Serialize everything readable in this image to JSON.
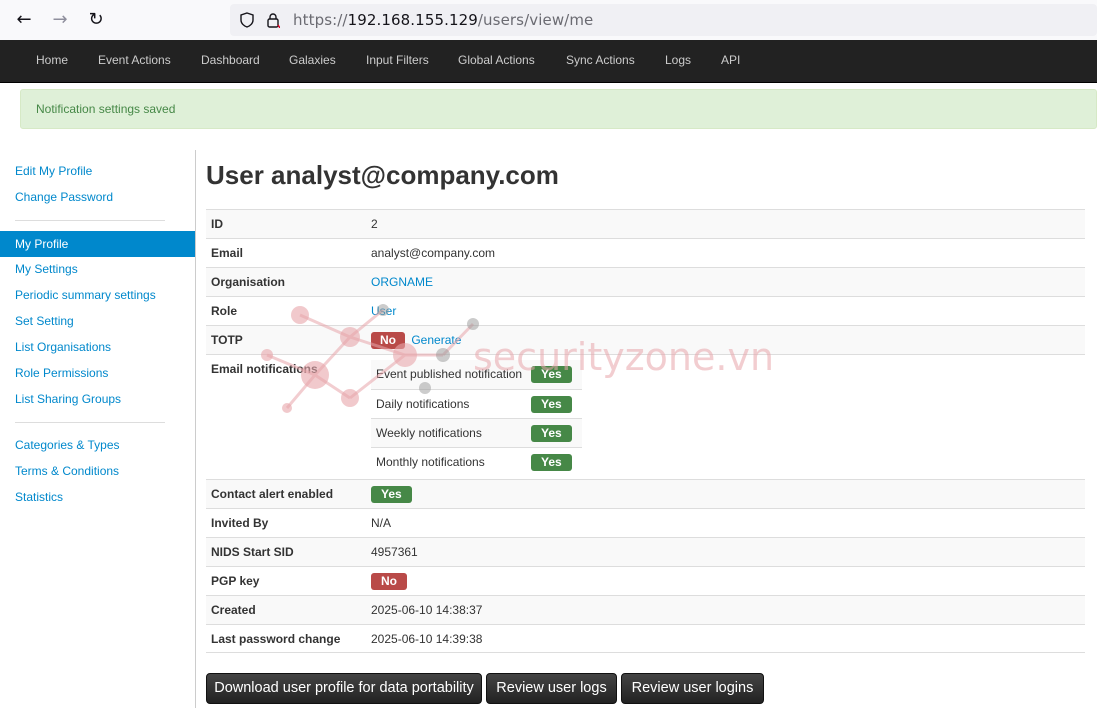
{
  "browser": {
    "url_prefix": "https://",
    "url_host": "192.168.155.129",
    "url_path": "/users/view/me"
  },
  "topnav": [
    "Home",
    "Event Actions",
    "Dashboard",
    "Galaxies",
    "Input Filters",
    "Global Actions",
    "Sync Actions",
    "Logs",
    "API"
  ],
  "alert": {
    "message": "Notification settings saved"
  },
  "sidebar": {
    "group1": [
      "Edit My Profile",
      "Change Password"
    ],
    "active": "My Profile",
    "group2": [
      "My Settings",
      "Periodic summary settings",
      "Set Setting",
      "List Organisations",
      "Role Permissions",
      "List Sharing Groups"
    ],
    "group3": [
      "Categories & Types",
      "Terms & Conditions",
      "Statistics"
    ]
  },
  "page": {
    "title": "User analyst@company.com"
  },
  "details": {
    "id_label": "ID",
    "id_value": "2",
    "email_label": "Email",
    "email_value": "analyst@company.com",
    "org_label": "Organisation",
    "org_value": "ORGNAME",
    "role_label": "Role",
    "role_value": "User",
    "totp_label": "TOTP",
    "totp_badge": "No",
    "totp_link": "Generate",
    "notif_label": "Email notifications",
    "notifications": [
      {
        "label": "Event published notification",
        "value": "Yes"
      },
      {
        "label": "Daily notifications",
        "value": "Yes"
      },
      {
        "label": "Weekly notifications",
        "value": "Yes"
      },
      {
        "label": "Monthly notifications",
        "value": "Yes"
      }
    ],
    "contact_label": "Contact alert enabled",
    "contact_badge": "Yes",
    "invited_label": "Invited By",
    "invited_value": "N/A",
    "nids_label": "NIDS Start SID",
    "nids_value": "4957361",
    "pgp_label": "PGP key",
    "pgp_badge": "No",
    "created_label": "Created",
    "created_value": "2025-06-10 14:38:37",
    "pwchange_label": "Last password change",
    "pwchange_value": "2025-06-10 14:39:38"
  },
  "buttons": {
    "download": "Download user profile for data portability",
    "logs": "Review user logs",
    "logins": "Review user logins"
  },
  "watermark": {
    "text": "securityzone.vn"
  },
  "colors": {
    "link": "#0088cc",
    "success": "#468847",
    "danger": "#b94a48",
    "navbar": "#222222",
    "alert_bg": "#dff0d8"
  }
}
